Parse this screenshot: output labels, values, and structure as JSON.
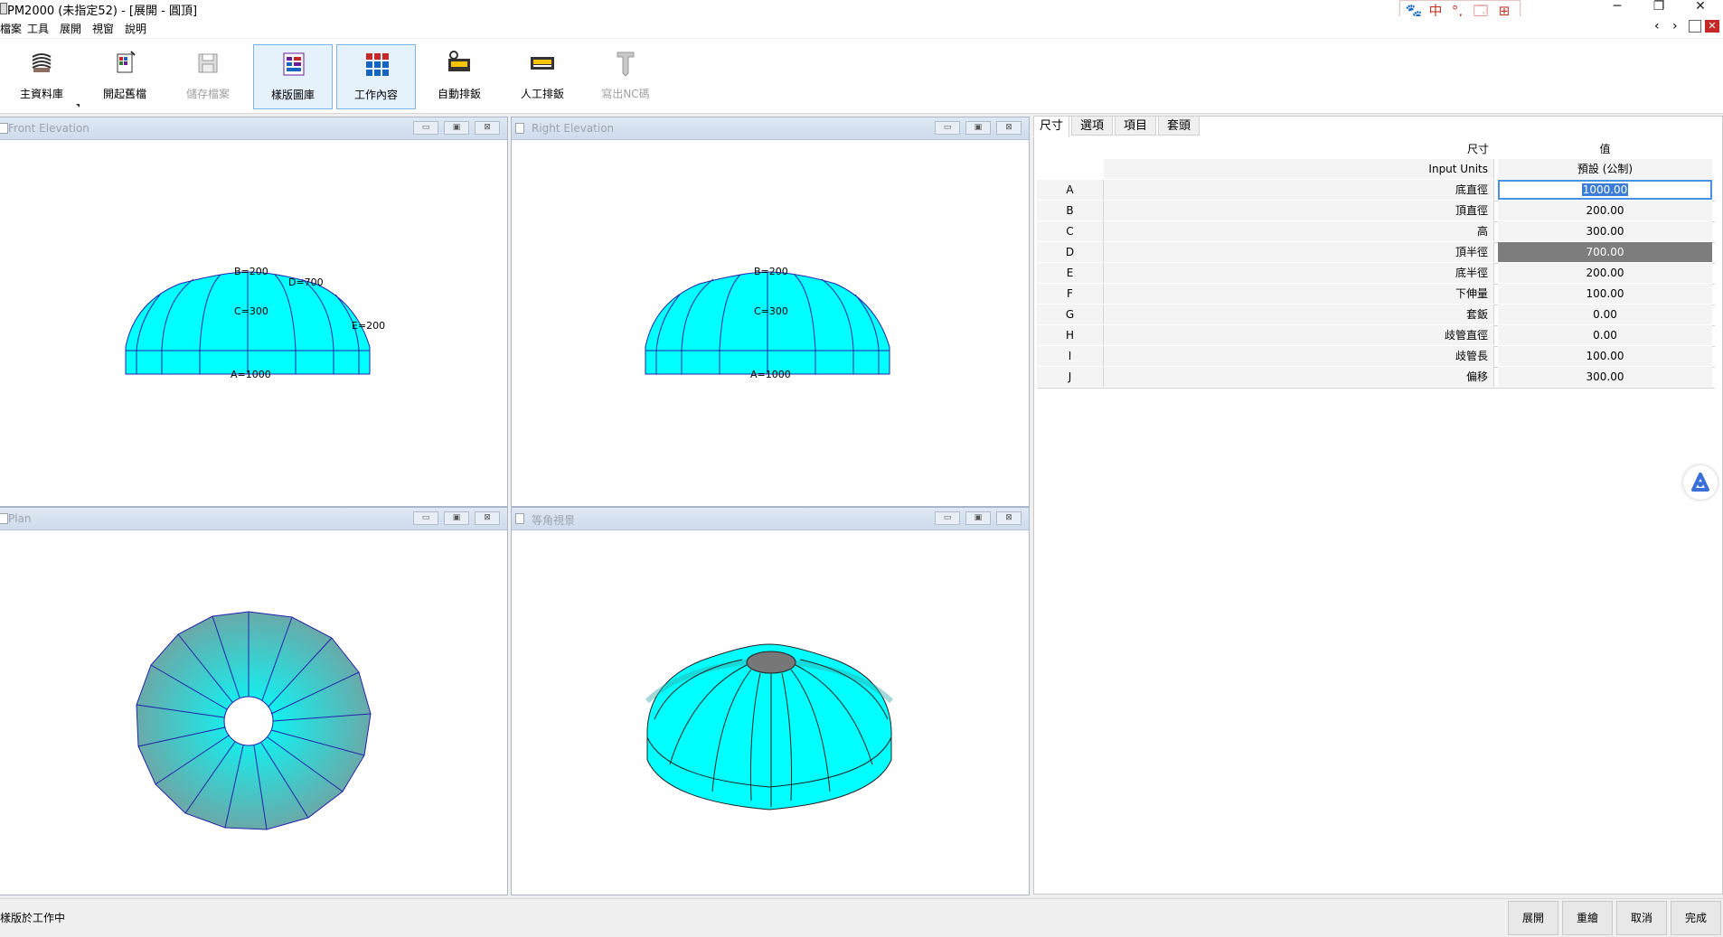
{
  "window": {
    "title": "PM2000 (未指定52) - [展開 - 圓頂]",
    "minimize": "─",
    "restore": "❐",
    "close": "✕"
  },
  "ime": {
    "items": [
      "🐾",
      "中",
      "°,",
      "🗔",
      "⊞"
    ]
  },
  "menu": {
    "items": [
      "檔案",
      "工具",
      "展開",
      "視窗",
      "說明"
    ]
  },
  "mdi_controls": {
    "prev": "‹",
    "next": "›"
  },
  "toolbar": {
    "items": [
      {
        "label": "主資料庫",
        "icon": "database-icon",
        "state": "normal"
      },
      {
        "label": "開起舊檔",
        "icon": "open-file-icon",
        "state": "normal"
      },
      {
        "label": "儲存檔案",
        "icon": "save-icon",
        "state": "disabled"
      },
      {
        "label": "樣版圖庫",
        "icon": "template-library-icon",
        "state": "active"
      },
      {
        "label": "工作內容",
        "icon": "work-content-icon",
        "state": "active"
      },
      {
        "label": "自動排鈑",
        "icon": "auto-nesting-icon",
        "state": "normal"
      },
      {
        "label": "人工排鈑",
        "icon": "manual-nesting-icon",
        "state": "normal"
      },
      {
        "label": "寫出NC碼",
        "icon": "nc-output-icon",
        "state": "disabled"
      }
    ]
  },
  "views": {
    "front": {
      "title": "Front Elevation",
      "labels": {
        "a": "A=1000",
        "b": "B=200",
        "c": "C=300",
        "d": "D=700",
        "e": "E=200"
      }
    },
    "right": {
      "title": "Right Elevation",
      "labels": {
        "a": "A=1000",
        "b": "B=200",
        "c": "C=300"
      }
    },
    "plan": {
      "title": "Plan"
    },
    "iso": {
      "title": "等角視景"
    },
    "buttons": {
      "min": "▭",
      "max": "▣",
      "close": "⊠"
    }
  },
  "panel": {
    "tabs": [
      "尺寸",
      "選項",
      "項目",
      "套頭"
    ],
    "header": {
      "name": "尺寸",
      "value": "值"
    },
    "units": {
      "name": "Input Units",
      "value": "預設 (公制)"
    },
    "rows": [
      {
        "key": "A",
        "name": "底直徑",
        "value": "1000.00"
      },
      {
        "key": "B",
        "name": "頂直徑",
        "value": "200.00"
      },
      {
        "key": "C",
        "name": "高",
        "value": "300.00"
      },
      {
        "key": "D",
        "name": "頂半徑",
        "value": "700.00"
      },
      {
        "key": "E",
        "name": "底半徑",
        "value": "200.00"
      },
      {
        "key": "F",
        "name": "下伸量",
        "value": "100.00"
      },
      {
        "key": "G",
        "name": "套鈑",
        "value": "0.00"
      },
      {
        "key": "H",
        "name": "歧管直徑",
        "value": "0.00"
      },
      {
        "key": "I",
        "name": "歧管長",
        "value": "100.00"
      },
      {
        "key": "J",
        "name": "偏移",
        "value": "300.00"
      }
    ]
  },
  "status": {
    "text": "樣版於工作中",
    "buttons": [
      "展開",
      "重繪",
      "取消",
      "完成"
    ]
  },
  "colors": {
    "shell": "#00ffff",
    "edge": "#2222aa",
    "accent": "#4a90e2"
  }
}
